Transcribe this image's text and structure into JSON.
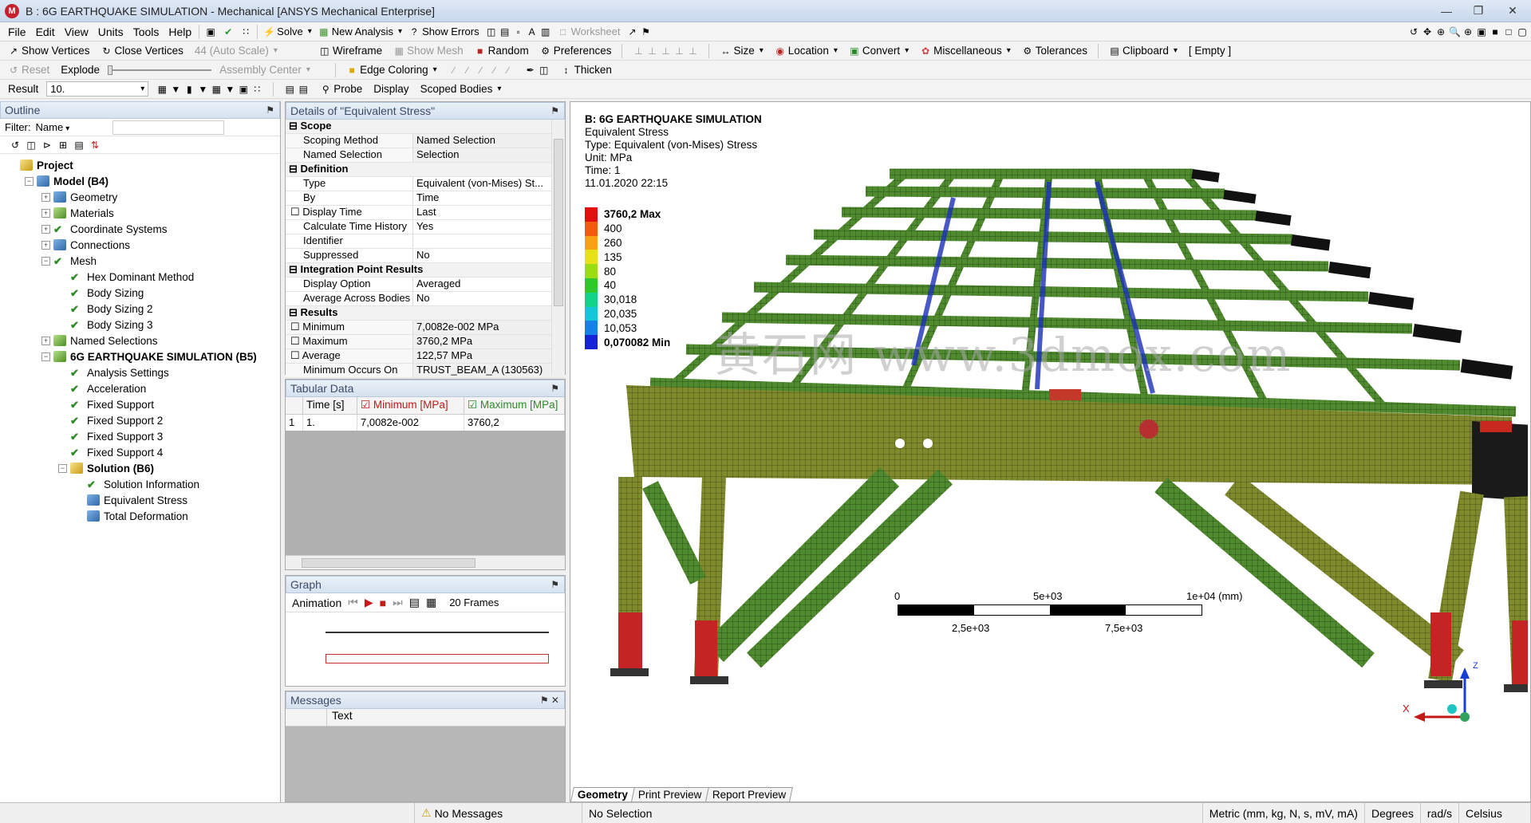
{
  "window": {
    "title": "B : 6G EARTHQUAKE SIMULATION - Mechanical [ANSYS Mechanical Enterprise]",
    "app_icon_letter": "M"
  },
  "menu": [
    "File",
    "Edit",
    "View",
    "Units",
    "Tools",
    "Help"
  ],
  "toolbar1": {
    "solve": "Solve",
    "new_analysis": "New Analysis",
    "show_errors": "Show Errors",
    "worksheet": "Worksheet"
  },
  "toolbar2": {
    "show_vertices": "Show Vertices",
    "close_vertices": "Close Vertices",
    "auto_scale": "44 (Auto Scale)",
    "wireframe": "Wireframe",
    "show_mesh": "Show Mesh",
    "random": "Random",
    "preferences": "Preferences",
    "size": "Size",
    "location": "Location",
    "convert": "Convert",
    "miscellaneous": "Miscellaneous",
    "tolerances": "Tolerances",
    "clipboard": "Clipboard",
    "empty": "[ Empty ]"
  },
  "toolbar3": {
    "reset": "Reset",
    "explode": "Explode",
    "assembly_center": "Assembly Center",
    "edge_coloring": "Edge Coloring",
    "thicken": "Thicken"
  },
  "toolbar4": {
    "result_label": "Result",
    "result_value": "10.",
    "probe": "Probe",
    "display_label": "Display",
    "display_value": "Scoped Bodies"
  },
  "outline": {
    "title": "Outline",
    "filter_label": "Filter:",
    "filter_value": "Name",
    "nodes": [
      {
        "label": "Project",
        "level": 0,
        "toggle": "",
        "icon": "yellow",
        "bold": true
      },
      {
        "label": "Model (B4)",
        "level": 1,
        "toggle": "−",
        "icon": "cube",
        "bold": true
      },
      {
        "label": "Geometry",
        "level": 2,
        "toggle": "+",
        "icon": "cube",
        "bold": false
      },
      {
        "label": "Materials",
        "level": 2,
        "toggle": "+",
        "icon": "green",
        "bold": false
      },
      {
        "label": "Coordinate Systems",
        "level": 2,
        "toggle": "+",
        "icon": "check",
        "bold": false
      },
      {
        "label": "Connections",
        "level": 2,
        "toggle": "+",
        "icon": "cube",
        "bold": false
      },
      {
        "label": "Mesh",
        "level": 2,
        "toggle": "−",
        "icon": "check",
        "bold": false
      },
      {
        "label": "Hex Dominant Method",
        "level": 3,
        "toggle": "",
        "icon": "check",
        "bold": false
      },
      {
        "label": "Body Sizing",
        "level": 3,
        "toggle": "",
        "icon": "check",
        "bold": false
      },
      {
        "label": "Body Sizing 2",
        "level": 3,
        "toggle": "",
        "icon": "check",
        "bold": false
      },
      {
        "label": "Body Sizing 3",
        "level": 3,
        "toggle": "",
        "icon": "check",
        "bold": false
      },
      {
        "label": "Named Selections",
        "level": 2,
        "toggle": "+",
        "icon": "green",
        "bold": false
      },
      {
        "label": "6G EARTHQUAKE SIMULATION (B5)",
        "level": 2,
        "toggle": "−",
        "icon": "green",
        "bold": true
      },
      {
        "label": "Analysis Settings",
        "level": 3,
        "toggle": "",
        "icon": "check",
        "bold": false
      },
      {
        "label": "Acceleration",
        "level": 3,
        "toggle": "",
        "icon": "check",
        "bold": false
      },
      {
        "label": "Fixed Support",
        "level": 3,
        "toggle": "",
        "icon": "check",
        "bold": false
      },
      {
        "label": "Fixed Support 2",
        "level": 3,
        "toggle": "",
        "icon": "check",
        "bold": false
      },
      {
        "label": "Fixed Support 3",
        "level": 3,
        "toggle": "",
        "icon": "check",
        "bold": false
      },
      {
        "label": "Fixed Support 4",
        "level": 3,
        "toggle": "",
        "icon": "check",
        "bold": false
      },
      {
        "label": "Solution (B6)",
        "level": 3,
        "toggle": "−",
        "icon": "yellow",
        "bold": true
      },
      {
        "label": "Solution Information",
        "level": 4,
        "toggle": "",
        "icon": "check",
        "bold": false
      },
      {
        "label": "Equivalent Stress",
        "level": 4,
        "toggle": "",
        "icon": "cube",
        "bold": false
      },
      {
        "label": "Total Deformation",
        "level": 4,
        "toggle": "",
        "icon": "cube",
        "bold": false
      }
    ]
  },
  "details": {
    "title": "Details of \"Equivalent Stress\"",
    "rows": [
      {
        "section": true,
        "k": "Scope",
        "v": ""
      },
      {
        "k": "Scoping Method",
        "v": "Named Selection",
        "shade": true
      },
      {
        "k": "Named Selection",
        "v": "Selection",
        "shade": true
      },
      {
        "section": true,
        "k": "Definition",
        "v": ""
      },
      {
        "k": "Type",
        "v": "Equivalent (von-Mises) St..."
      },
      {
        "k": "By",
        "v": "Time"
      },
      {
        "k": "Display Time",
        "v": "Last",
        "check": true
      },
      {
        "k": "Calculate Time History",
        "v": "Yes"
      },
      {
        "k": "Identifier",
        "v": ""
      },
      {
        "k": "Suppressed",
        "v": "No"
      },
      {
        "section": true,
        "k": "Integration Point Results",
        "v": ""
      },
      {
        "k": "Display Option",
        "v": "Averaged"
      },
      {
        "k": "Average Across Bodies",
        "v": "No"
      },
      {
        "section": true,
        "k": "Results",
        "v": ""
      },
      {
        "k": "Minimum",
        "v": "7,0082e-002 MPa",
        "check": true,
        "shade": true
      },
      {
        "k": "Maximum",
        "v": "3760,2 MPa",
        "check": true,
        "shade": true
      },
      {
        "k": "Average",
        "v": "122,57 MPa",
        "check": true,
        "shade": true
      },
      {
        "k": "Minimum Occurs On",
        "v": "TRUST_BEAM_A (130563)",
        "shade": true
      }
    ]
  },
  "tabular": {
    "title": "Tabular Data",
    "headers": [
      "",
      "Time [s]",
      "Minimum [MPa]",
      "Maximum [MPa]"
    ],
    "rows": [
      [
        "1",
        "1.",
        "7,0082e-002",
        "3760,2"
      ]
    ]
  },
  "graph": {
    "title": "Graph",
    "animation": "Animation",
    "frames": "20 Frames"
  },
  "messages": {
    "title": "Messages",
    "column": "Text"
  },
  "viewer": {
    "info": [
      "B: 6G EARTHQUAKE SIMULATION",
      "Equivalent Stress",
      "Type: Equivalent (von-Mises) Stress",
      "Unit: MPa",
      "Time: 1",
      "11.01.2020 22:15"
    ],
    "legend": [
      {
        "label": "3760,2 Max",
        "color": "#e01010",
        "bold": true
      },
      {
        "label": "400",
        "color": "#f25a10",
        "bold": false
      },
      {
        "label": "260",
        "color": "#f5a312",
        "bold": false
      },
      {
        "label": "135",
        "color": "#e7e117",
        "bold": false
      },
      {
        "label": "80",
        "color": "#9bdc12",
        "bold": false
      },
      {
        "label": "40",
        "color": "#2fc82c",
        "bold": false
      },
      {
        "label": "30,018",
        "color": "#12d38a",
        "bold": false
      },
      {
        "label": "20,035",
        "color": "#12c7d8",
        "bold": false
      },
      {
        "label": "10,053",
        "color": "#1680e8",
        "bold": false
      },
      {
        "label": "0,070082 Min",
        "color": "#1622d8",
        "bold": true
      }
    ],
    "watermark": "黄石网 www.3dmox.com",
    "scale": {
      "t0": "0",
      "t1": "5e+03",
      "t2": "1e+04 (mm)",
      "b1": "2,5e+03",
      "b2": "7,5e+03"
    },
    "triad_x": "X",
    "triad_z": "Z",
    "tabs": [
      "Geometry",
      "Print Preview",
      "Report Preview"
    ]
  },
  "status": {
    "messages": "No Messages",
    "selection": "No Selection",
    "units": "Metric (mm, kg, N, s, mV, mA)",
    "angle": "Degrees",
    "rot": "rad/s",
    "temp": "Celsius"
  },
  "colors": {
    "frame_green": "#3f7a2c",
    "high_stress": "#d42121",
    "low_stress": "#1f3fc2"
  }
}
